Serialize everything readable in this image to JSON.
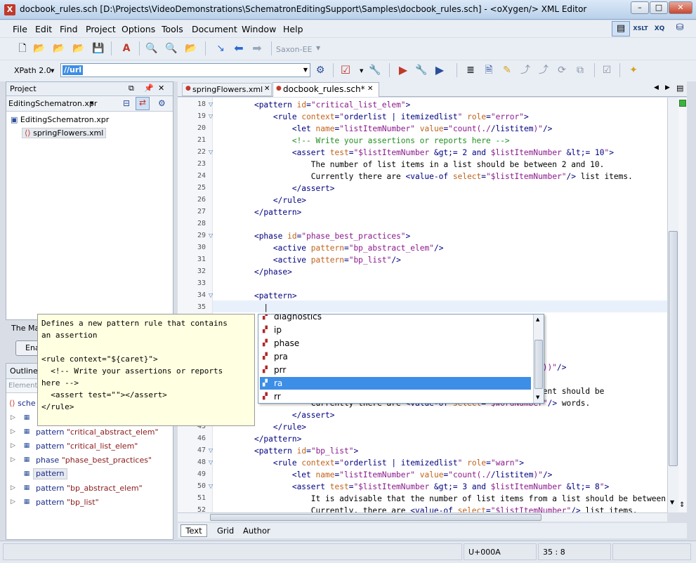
{
  "window": {
    "title": "docbook_rules.sch [D:\\Projects\\VideoDemonstrations\\SchematronEditingSupport\\Samples\\docbook_rules.sch] - <oXygen/> XML Editor",
    "app_icon": "X",
    "minimize": "–",
    "maximize": "□",
    "close": "✕"
  },
  "menu": [
    "File",
    "Edit",
    "Find",
    "Project",
    "Options",
    "Tools",
    "Document",
    "Window",
    "Help"
  ],
  "perspectives": {
    "xslt": "XSLT",
    "xquery": "XQ"
  },
  "toolbar": {
    "transformer": "Saxon-EE"
  },
  "xpath": {
    "label": "XPath 2.0",
    "value": "//url"
  },
  "project_panel": {
    "title": "Project",
    "project_file": "EditingSchematron.xpr",
    "tree": [
      "EditingSchematron.xpr",
      "springFlowers.xml"
    ],
    "partial_text": "The Ma",
    "partial_button": "Ena"
  },
  "outline_panel": {
    "title": "Outline",
    "filter_placeholder": "Element",
    "root": "sche",
    "items": [
      {
        "kw": "pattern",
        "val": "\"critical_abstract_elem\""
      },
      {
        "kw": "pattern",
        "val": "\"critical_list_elem\""
      },
      {
        "kw": "phase",
        "val": "\"phase_best_practices\""
      },
      {
        "kw": "pattern",
        "val": ""
      },
      {
        "kw": "pattern",
        "val": "\"bp_abstract_elem\""
      },
      {
        "kw": "pattern",
        "val": "\"bp_list\""
      }
    ]
  },
  "tabs": [
    {
      "label": "springFlowers.xml",
      "active": false
    },
    {
      "label": "docbook_rules.sch*",
      "active": true
    }
  ],
  "editor_modes": [
    "Text",
    "Grid",
    "Author"
  ],
  "code_lines": [
    {
      "n": "18",
      "fold": true,
      "tokens": [
        [
          "x",
          "    "
        ],
        [
          "t",
          "<pattern"
        ],
        [
          "x",
          " "
        ],
        [
          "a",
          "id"
        ],
        [
          "t",
          "="
        ],
        [
          "v",
          "\"critical_list_elem\""
        ],
        [
          "t",
          ">"
        ]
      ]
    },
    {
      "n": "19",
      "fold": true,
      "tokens": [
        [
          "x",
          "        "
        ],
        [
          "t",
          "<rule"
        ],
        [
          "x",
          " "
        ],
        [
          "a",
          "context"
        ],
        [
          "t",
          "="
        ],
        [
          "v",
          "\""
        ],
        [
          "t",
          "orderlist | itemizedlist"
        ],
        [
          "v",
          "\""
        ],
        [
          "x",
          " "
        ],
        [
          "a",
          "role"
        ],
        [
          "t",
          "="
        ],
        [
          "v",
          "\"error\""
        ],
        [
          "t",
          ">"
        ]
      ]
    },
    {
      "n": "20",
      "fold": false,
      "tokens": [
        [
          "x",
          "            "
        ],
        [
          "t",
          "<let"
        ],
        [
          "x",
          " "
        ],
        [
          "a",
          "name"
        ],
        [
          "t",
          "="
        ],
        [
          "v",
          "\"listItemNumber\""
        ],
        [
          "x",
          " "
        ],
        [
          "a",
          "value"
        ],
        [
          "t",
          "="
        ],
        [
          "v",
          "\"count(./"
        ],
        [
          "t",
          "/listitem"
        ],
        [
          "v",
          ")\""
        ],
        [
          "t",
          "/>"
        ]
      ]
    },
    {
      "n": "21",
      "fold": false,
      "tokens": [
        [
          "x",
          "            "
        ],
        [
          "c",
          "<!-- Write your assertions or reports here -->"
        ]
      ]
    },
    {
      "n": "22",
      "fold": true,
      "tokens": [
        [
          "x",
          "            "
        ],
        [
          "t",
          "<assert"
        ],
        [
          "x",
          " "
        ],
        [
          "a",
          "test"
        ],
        [
          "t",
          "="
        ],
        [
          "v",
          "\"$listItemNumber "
        ],
        [
          "t",
          "&gt;= 2 and "
        ],
        [
          "v",
          "$listItemNumber "
        ],
        [
          "t",
          "&lt;= 10"
        ],
        [
          "v",
          "\""
        ],
        [
          "t",
          ">"
        ]
      ]
    },
    {
      "n": "23",
      "fold": false,
      "tokens": [
        [
          "x",
          "                The number of list items in a list should be between 2 and 10."
        ]
      ]
    },
    {
      "n": "24",
      "fold": false,
      "tokens": [
        [
          "x",
          "                Currently there are "
        ],
        [
          "t",
          "<value-of"
        ],
        [
          "x",
          " "
        ],
        [
          "a",
          "select"
        ],
        [
          "t",
          "="
        ],
        [
          "v",
          "\"$listItemNumber\""
        ],
        [
          "t",
          "/>"
        ],
        [
          "x",
          " list items."
        ]
      ]
    },
    {
      "n": "25",
      "fold": false,
      "tokens": [
        [
          "x",
          "            "
        ],
        [
          "t",
          "</assert>"
        ]
      ]
    },
    {
      "n": "26",
      "fold": false,
      "tokens": [
        [
          "x",
          "        "
        ],
        [
          "t",
          "</rule>"
        ]
      ]
    },
    {
      "n": "27",
      "fold": false,
      "tokens": [
        [
          "x",
          "    "
        ],
        [
          "t",
          "</pattern>"
        ]
      ]
    },
    {
      "n": "28",
      "fold": false,
      "tokens": []
    },
    {
      "n": "29",
      "fold": true,
      "tokens": [
        [
          "x",
          "    "
        ],
        [
          "t",
          "<phase"
        ],
        [
          "x",
          " "
        ],
        [
          "a",
          "id"
        ],
        [
          "t",
          "="
        ],
        [
          "v",
          "\"phase_best_practices\""
        ],
        [
          "t",
          ">"
        ]
      ]
    },
    {
      "n": "30",
      "fold": false,
      "tokens": [
        [
          "x",
          "        "
        ],
        [
          "t",
          "<active"
        ],
        [
          "x",
          " "
        ],
        [
          "a",
          "pattern"
        ],
        [
          "t",
          "="
        ],
        [
          "v",
          "\"bp_abstract_elem\""
        ],
        [
          "t",
          "/>"
        ]
      ]
    },
    {
      "n": "31",
      "fold": false,
      "tokens": [
        [
          "x",
          "        "
        ],
        [
          "t",
          "<active"
        ],
        [
          "x",
          " "
        ],
        [
          "a",
          "pattern"
        ],
        [
          "t",
          "="
        ],
        [
          "v",
          "\"bp_list\""
        ],
        [
          "t",
          "/>"
        ]
      ]
    },
    {
      "n": "32",
      "fold": false,
      "tokens": [
        [
          "x",
          "    "
        ],
        [
          "t",
          "</phase>"
        ]
      ]
    },
    {
      "n": "33",
      "fold": false,
      "tokens": []
    },
    {
      "n": "34",
      "fold": true,
      "tokens": [
        [
          "x",
          "    "
        ],
        [
          "t",
          "<pattern>"
        ]
      ]
    },
    {
      "n": "35",
      "fold": false,
      "tokens": [
        [
          "x",
          "      |"
        ]
      ]
    },
    {
      "n": "36",
      "fold": false,
      "tokens": [
        [
          "x",
          "      "
        ],
        [
          "t",
          "<"
        ]
      ]
    },
    {
      "n": "37",
      "fold": false,
      "tokens": []
    },
    {
      "n": "38",
      "fold": false,
      "tokens": [
        [
          "x",
          "      "
        ],
        [
          "t",
          "<"
        ]
      ]
    },
    {
      "n": "39",
      "fold": false,
      "tokens": [
        [
          "x",
          "      "
        ],
        [
          "t",
          "<"
        ]
      ]
    },
    {
      "n": "40",
      "fold": false,
      "tokens": [
        [
          "x",
          "                                                    "
        ],
        [
          "v",
          "space(.), ' '))\""
        ],
        [
          "t",
          "/>"
        ]
      ]
    },
    {
      "n": "41",
      "fold": false,
      "tokens": [
        [
          "x",
          "                                                    "
        ],
        [
          "v",
          "80\""
        ],
        [
          "t",
          ">"
        ]
      ]
    },
    {
      "n": "42",
      "fold": false,
      "tokens": [
        [
          "x",
          "                                                     bstract element should be"
        ]
      ]
    },
    {
      "n": "43",
      "fold": false,
      "tokens": [
        [
          "x",
          "                Currently there are "
        ],
        [
          "t",
          "<value-of"
        ],
        [
          "x",
          " "
        ],
        [
          "a",
          "select"
        ],
        [
          "t",
          "="
        ],
        [
          "v",
          "\"$wordNumber\""
        ],
        [
          "t",
          "/>"
        ],
        [
          "x",
          " words."
        ]
      ]
    },
    {
      "n": "44",
      "fold": false,
      "tokens": [
        [
          "x",
          "            "
        ],
        [
          "t",
          "</assert>"
        ]
      ]
    },
    {
      "n": "45",
      "fold": false,
      "tokens": [
        [
          "x",
          "        "
        ],
        [
          "t",
          "</rule>"
        ]
      ]
    },
    {
      "n": "46",
      "fold": false,
      "tokens": [
        [
          "x",
          "    "
        ],
        [
          "t",
          "</pattern>"
        ]
      ]
    },
    {
      "n": "47",
      "fold": true,
      "tokens": [
        [
          "x",
          "    "
        ],
        [
          "t",
          "<pattern"
        ],
        [
          "x",
          " "
        ],
        [
          "a",
          "id"
        ],
        [
          "t",
          "="
        ],
        [
          "v",
          "\"bp_list\""
        ],
        [
          "t",
          ">"
        ]
      ]
    },
    {
      "n": "48",
      "fold": true,
      "tokens": [
        [
          "x",
          "        "
        ],
        [
          "t",
          "<rule"
        ],
        [
          "x",
          " "
        ],
        [
          "a",
          "context"
        ],
        [
          "t",
          "="
        ],
        [
          "v",
          "\""
        ],
        [
          "t",
          "orderlist | itemizedlist"
        ],
        [
          "v",
          "\""
        ],
        [
          "x",
          " "
        ],
        [
          "a",
          "role"
        ],
        [
          "t",
          "="
        ],
        [
          "v",
          "\"warn\""
        ],
        [
          "t",
          ">"
        ]
      ]
    },
    {
      "n": "49",
      "fold": false,
      "tokens": [
        [
          "x",
          "            "
        ],
        [
          "t",
          "<let"
        ],
        [
          "x",
          " "
        ],
        [
          "a",
          "name"
        ],
        [
          "t",
          "="
        ],
        [
          "v",
          "\"listItemNumber\""
        ],
        [
          "x",
          " "
        ],
        [
          "a",
          "value"
        ],
        [
          "t",
          "="
        ],
        [
          "v",
          "\"count(./"
        ],
        [
          "t",
          "/listitem"
        ],
        [
          "v",
          ")\""
        ],
        [
          "t",
          "/>"
        ]
      ]
    },
    {
      "n": "50",
      "fold": true,
      "tokens": [
        [
          "x",
          "            "
        ],
        [
          "t",
          "<assert"
        ],
        [
          "x",
          " "
        ],
        [
          "a",
          "test"
        ],
        [
          "t",
          "="
        ],
        [
          "v",
          "\"$listItemNumber "
        ],
        [
          "t",
          "&gt;= 3 and "
        ],
        [
          "v",
          "$listItemNumber "
        ],
        [
          "t",
          "&lt;= 8"
        ],
        [
          "v",
          "\""
        ],
        [
          "t",
          ">"
        ]
      ]
    },
    {
      "n": "51",
      "fold": false,
      "tokens": [
        [
          "x",
          "                It is advisable that the number of list items from a list should be between"
        ]
      ]
    },
    {
      "n": "52",
      "fold": false,
      "tokens": [
        [
          "x",
          "                Currently, there are "
        ],
        [
          "t",
          "<value-of"
        ],
        [
          "x",
          " "
        ],
        [
          "a",
          "select"
        ],
        [
          "t",
          "="
        ],
        [
          "v",
          "\"$listItemNumber\""
        ],
        [
          "t",
          "/>"
        ],
        [
          "x",
          " list items."
        ]
      ]
    }
  ],
  "completion": {
    "items": [
      "diagnostics",
      "ip",
      "phase",
      "pra",
      "prr",
      "ra",
      "rr"
    ],
    "selected_index": 5
  },
  "doc_tip": {
    "text": "Defines a new pattern rule that contains\nan assertion\n\n<rule context=\"${caret}\">\n  <!-- Write your assertions or reports\nhere -->\n  <assert test=\"\"></assert>\n</rule>"
  },
  "status": {
    "unicode": "U+000A",
    "position": "35 : 8"
  },
  "colors": {
    "selection": "#3d8ee6",
    "current_line": "#e8f1fb",
    "tip_bg": "#ffffe1"
  }
}
